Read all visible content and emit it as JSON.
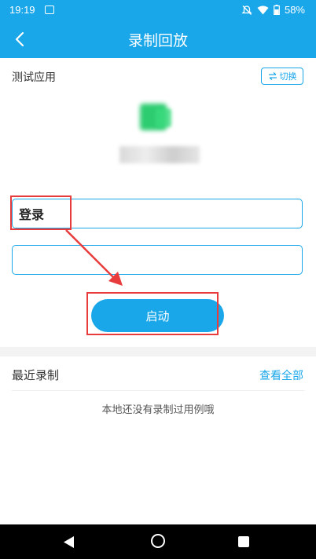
{
  "status_bar": {
    "time": "19:19",
    "battery": "58%",
    "icons": [
      "image-icon",
      "mute-icon",
      "wifi-icon",
      "battery-icon"
    ]
  },
  "header": {
    "title": "录制回放",
    "back_icon": "back-arrow-icon",
    "background_color": "#1aa7e9"
  },
  "app_section": {
    "label": "测试应用",
    "switch_label": "切换",
    "switch_icon": "swap-icon",
    "app_icon": "app-icon-blurred"
  },
  "form": {
    "field1_value": "登录",
    "field2_value": ""
  },
  "start_button": {
    "label": "启动"
  },
  "recent": {
    "title": "最近录制",
    "view_all": "查看全部",
    "empty_message": "本地还没有录制过用例哦"
  },
  "colors": {
    "accent": "#1aa7e9",
    "annotation": "#e83b3b"
  }
}
